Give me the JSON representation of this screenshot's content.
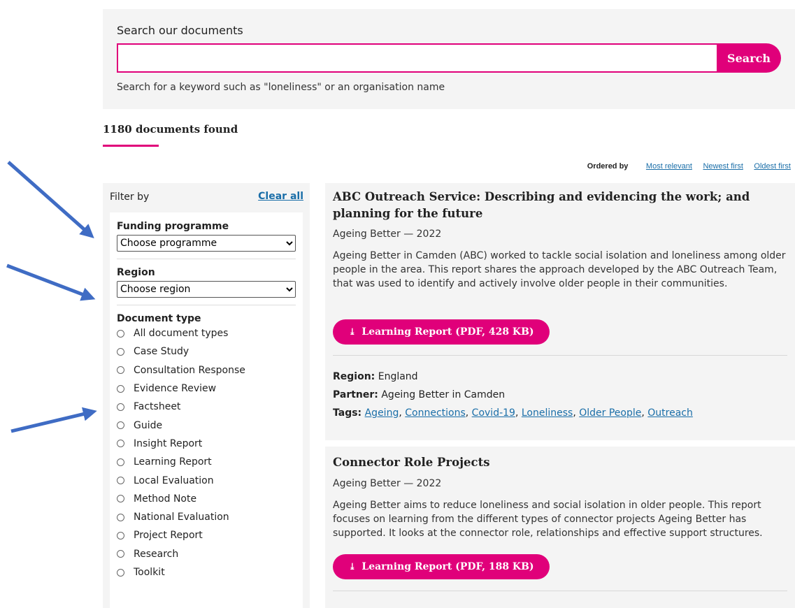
{
  "search": {
    "title": "Search our documents",
    "placeholder": "",
    "button_label": "Search",
    "hint": "Search for a keyword such as \"loneliness\" or an organisation name"
  },
  "results": {
    "count_label": "1180 documents found"
  },
  "ordering": {
    "label": "Ordered by",
    "options": [
      "Most relevant",
      "Newest first",
      "Oldest first"
    ]
  },
  "filters": {
    "header": "Filter by",
    "clear_all": "Clear all",
    "funding_label": "Funding programme",
    "funding_selected": "Choose programme",
    "region_label": "Region",
    "region_selected": "Choose region",
    "doc_type_label": "Document type",
    "doc_types": [
      "All document types",
      "Case Study",
      "Consultation Response",
      "Evidence Review",
      "Factsheet",
      "Guide",
      "Insight Report",
      "Learning Report",
      "Local Evaluation",
      "Method Note",
      "National Evaluation",
      "Project Report",
      "Research",
      "Toolkit"
    ]
  },
  "documents": [
    {
      "title": "ABC Outreach Service: Describing and evidencing the work; and planning for the future",
      "meta": "Ageing Better — 2022",
      "description": "Ageing Better in Camden (ABC) worked to tackle social isolation and loneliness among older people in the area. This report shares the approach developed by the ABC Outreach Team, that was used to identify and actively involve older people in their communities.",
      "download_label": "Learning Report (PDF, 428 KB)",
      "region_key": "Region:",
      "region_value": "England",
      "partner_key": "Partner:",
      "partner_value": "Ageing Better in Camden",
      "tags_key": "Tags:",
      "tags": [
        "Ageing",
        "Connections",
        "Covid-19",
        "Loneliness",
        "Older People",
        "Outreach"
      ]
    },
    {
      "title": "Connector Role Projects",
      "meta": "Ageing Better — 2022",
      "description": "Ageing Better aims to reduce loneliness and social isolation in older people. This report focuses on learning from the different types of connector projects Ageing Better has supported. It looks at the connector role, relationships and effective support structures.",
      "download_label": "Learning Report (PDF, 188 KB)"
    }
  ],
  "colors": {
    "accent": "#e0007a",
    "link": "#1a6ea8",
    "panel": "#f4f4f4",
    "arrow": "#3f6cc4"
  }
}
